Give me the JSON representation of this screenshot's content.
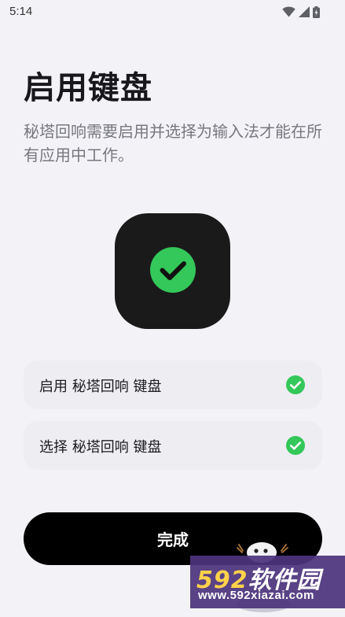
{
  "status_bar": {
    "time": "5:14",
    "icons": [
      "wifi-icon",
      "signal-icon",
      "battery-icon"
    ]
  },
  "page": {
    "title": "启用键盘",
    "description": "秘塔回响需要启用并选择为输入法才能在所有应用中工作。"
  },
  "app_icon": {
    "icon": "check-circle-icon",
    "check_color": "#34C759",
    "background": "#1A1A1A"
  },
  "steps": [
    {
      "label": "启用 秘塔回响 键盘",
      "done": true,
      "icon": "check-circle-icon"
    },
    {
      "label": "选择 秘塔回响 键盘",
      "done": true,
      "icon": "check-circle-icon"
    }
  ],
  "actions": {
    "done_label": "完成"
  },
  "watermark": {
    "brand_num": "592",
    "brand_text": "软件园",
    "url": "www.592xiazai.com"
  },
  "colors": {
    "background": "#F3F3F7",
    "card": "#EDEDF2",
    "primary_button": "#000000",
    "success": "#34C759"
  }
}
